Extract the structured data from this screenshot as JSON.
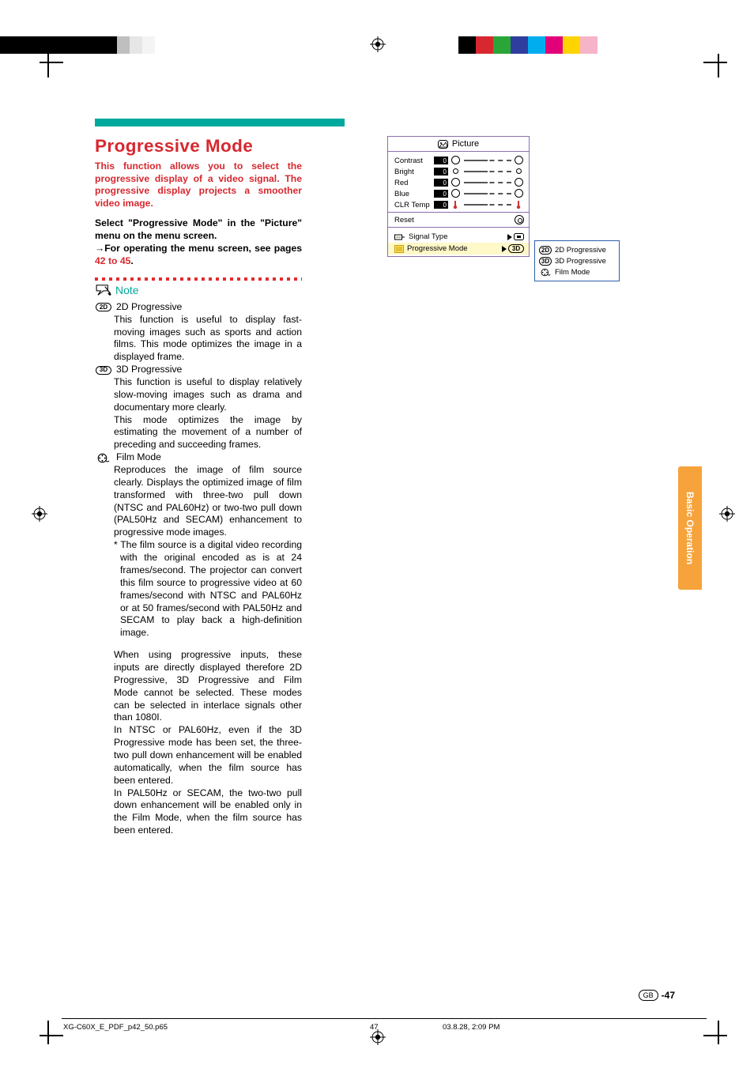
{
  "topbars_left": [
    "#000",
    "#000",
    "#000",
    "#000",
    "#000",
    "#000",
    "#000",
    "#fff",
    "#fff",
    "#fff"
  ],
  "topbars_right": [
    "#000",
    "#d7282f",
    "#29a637",
    "#2f3e9e",
    "#00aeef",
    "#e20079",
    "#fdd400",
    "#f6b4c8"
  ],
  "heading": "Progressive Mode",
  "intro": "This function allows you to select the progressive display of a video signal. The progressive display projects a smoother video image.",
  "select_l1": "Select \"Progressive Mode\" in the \"Picture\" menu on the menu screen.",
  "select_l2a": "→",
  "select_l2b": "For operating the menu screen, see pages ",
  "select_ref": "42 to 45",
  "select_l2c": ".",
  "note_label": "Note",
  "modes": {
    "m2d_title": "2D Progressive",
    "m2d_body": "This function is useful to display fast-moving images such as sports and action films. This mode optimizes the image in a displayed frame.",
    "m3d_title": "3D Progressive",
    "m3d_body1": "This function is useful to display relatively slow-moving images such as drama and documentary more clearly.",
    "m3d_body2": "This mode optimizes the image by estimating the movement of a number of preceding and succeeding frames.",
    "film_title": "Film Mode",
    "film_body": "Reproduces the image of film source clearly. Displays the optimized image of film transformed with three-two pull down (NTSC and PAL60Hz) or two-two pull down (PAL50Hz and SECAM) enhancement to progressive mode images.",
    "film_ast": "* The film source is a digital video recording with the original encoded as is at 24 frames/second. The projector can convert this film source to progressive video at 60 frames/second with NTSC and PAL60Hz or at 50 frames/second with PAL50Hz and SECAM to play back a high-definition image."
  },
  "para2": "When using progressive inputs, these inputs are directly displayed therefore 2D Progressive, 3D Progressive and Film Mode cannot be selected. These modes can be selected in interlace signals other than 1080I.",
  "para3": "In NTSC or PAL60Hz, even if the 3D Progressive mode has been set, the three-two pull down enhancement will be enabled automatically, when the film source has been entered.",
  "para4": "In PAL50Hz or SECAM, the two-two pull down enhancement will be enabled only in the Film Mode, when the film source has been entered.",
  "osd": {
    "title": "Picture",
    "rows": [
      {
        "label": "Contrast",
        "val": "0"
      },
      {
        "label": "Bright",
        "val": "0"
      },
      {
        "label": "Red",
        "val": "0"
      },
      {
        "label": "Blue",
        "val": "0"
      },
      {
        "label": "CLR Temp",
        "val": "0"
      }
    ],
    "reset": "Reset",
    "sig": "Signal Type",
    "prog": "Progressive Mode",
    "prog_val": "3D"
  },
  "popout": {
    "o1": "2D Progressive",
    "o2": "3D Progressive",
    "o3": "Film Mode"
  },
  "icons": {
    "i2d": "2D",
    "i3d": "3D"
  },
  "sidetab": "Basic Operation",
  "page_gb": "GB",
  "page_no": "-47",
  "footer_left": "XG-C60X_E_PDF_p42_50.p65",
  "footer_mid": "47",
  "footer_right": "03.8.28, 2:09 PM"
}
